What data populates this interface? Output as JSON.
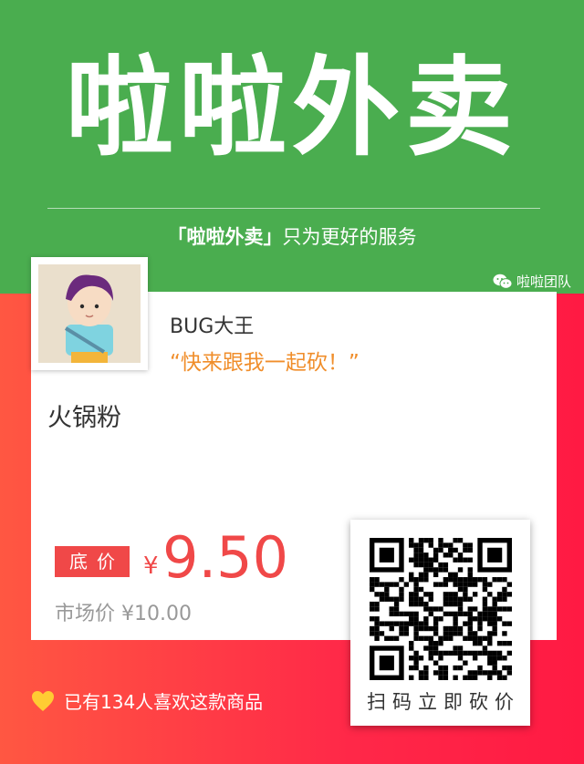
{
  "header": {
    "brand": "啦啦外卖",
    "slogan_brand": "「啦啦外卖」",
    "slogan_text": "只为更好的服务",
    "team": "啦啦团队",
    "color": "#4aad4f"
  },
  "card": {
    "username": "BUG大王",
    "quote": "“快来跟我一起砍！”",
    "product_name": "火锅粉",
    "price_tag": "底价",
    "currency": "¥",
    "price": "9.50",
    "market_price": "市场价 ¥10.00",
    "accent_color": "#f04848",
    "quote_color": "#f08e2b"
  },
  "qr": {
    "label": "扫码立即砍价"
  },
  "likes": {
    "text": "已有134人喜欢这款商品",
    "icon": "heart-icon",
    "icon_color": "#ffcc33"
  },
  "icons": {
    "wechat": "wechat-icon",
    "avatar": "avatar-illustration"
  }
}
